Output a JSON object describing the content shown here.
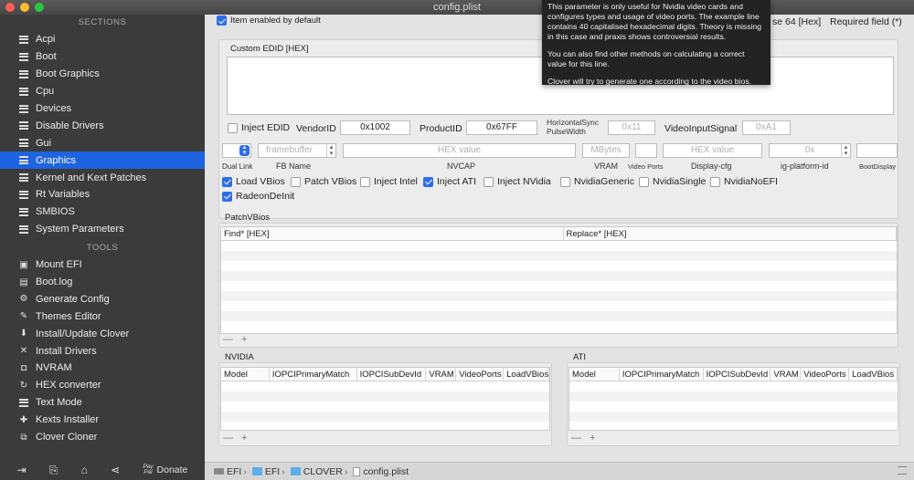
{
  "window": {
    "title": "config.plist"
  },
  "sidebar": {
    "sections_header": "SECTIONS",
    "sections": [
      {
        "label": "Acpi",
        "icon": "list-icon"
      },
      {
        "label": "Boot",
        "icon": "list-icon"
      },
      {
        "label": "Boot Graphics",
        "icon": "list-icon"
      },
      {
        "label": "Cpu",
        "icon": "list-icon"
      },
      {
        "label": "Devices",
        "icon": "list-icon"
      },
      {
        "label": "Disable Drivers",
        "icon": "list-icon"
      },
      {
        "label": "Gui",
        "icon": "list-icon"
      },
      {
        "label": "Graphics",
        "icon": "list-icon",
        "active": true
      },
      {
        "label": "Kernel and Kext Patches",
        "icon": "list-icon"
      },
      {
        "label": "Rt Variables",
        "icon": "list-icon"
      },
      {
        "label": "SMBIOS",
        "icon": "list-icon"
      },
      {
        "label": "System Parameters",
        "icon": "list-icon"
      }
    ],
    "tools_header": "TOOLS",
    "tools": [
      {
        "label": "Mount EFI",
        "icon": "disk-icon"
      },
      {
        "label": "Boot.log",
        "icon": "document-icon"
      },
      {
        "label": "Generate Config",
        "icon": "gears-icon"
      },
      {
        "label": "Themes Editor",
        "icon": "brush-icon"
      },
      {
        "label": "Install/Update Clover",
        "icon": "download-icon"
      },
      {
        "label": "Install Drivers",
        "icon": "tools-icon"
      },
      {
        "label": "NVRAM",
        "icon": "chip-icon"
      },
      {
        "label": "HEX converter",
        "icon": "refresh-icon"
      },
      {
        "label": "Text Mode",
        "icon": "list-icon"
      },
      {
        "label": "Kexts Installer",
        "icon": "puzzle-icon"
      },
      {
        "label": "Clover Cloner",
        "icon": "clone-icon"
      }
    ],
    "bottom": {
      "paypal_top": "Pay",
      "paypal_bottom": "Pal",
      "donate": "Donate"
    }
  },
  "main": {
    "item_enabled": "Item enabled by default",
    "right_header_base": "se 64 [Hex]",
    "right_header_required": "Required field (*)",
    "custom_edid_label": "Custom EDID [HEX]",
    "inject_edid": "Inject EDID",
    "vendor_id_label": "VendorID",
    "vendor_id": "0x1002",
    "product_id_label": "ProductID",
    "product_id": "0x67FF",
    "hsync_label_1": "HorizontalSync",
    "hsync_label_2": "PulseWidth",
    "hsync_value": "0x11",
    "video_input_label": "VideoInputSignal",
    "video_input_value": "0xA1",
    "framebuffer_ph": "framebuffer",
    "nvcap_ph": "HEX value",
    "vram_ph": "MBytes",
    "display_cfg_ph": "HEX value",
    "platform_id_ph": "0x",
    "labels_row": {
      "dual_link": "Dual Link",
      "fb_name": "FB Name",
      "nvcap": "NVCAP",
      "vram": "VRAM",
      "video_ports": "Video Ports",
      "display_cfg": "Display-cfg",
      "platform_id": "ig-platform-id",
      "boot_display": "BootDisplay"
    },
    "checks": [
      {
        "label": "Load VBios",
        "checked": true
      },
      {
        "label": "Patch VBios",
        "checked": false
      },
      {
        "label": "Inject Intel",
        "checked": false
      },
      {
        "label": "Inject ATI",
        "checked": true
      },
      {
        "label": "Inject NVidia",
        "checked": false
      },
      {
        "label": "NvidiaGeneric",
        "checked": false
      },
      {
        "label": "NvidiaSingle",
        "checked": false
      },
      {
        "label": "NvidiaNoEFI",
        "checked": false
      },
      {
        "label": "RadeonDeInit",
        "checked": true
      }
    ],
    "patch_vbios": {
      "title": "PatchVBios",
      "columns": [
        "Find* [HEX]",
        "Replace* [HEX]"
      ],
      "add_remove": "— +"
    },
    "nvidia": {
      "title": "NVIDIA",
      "columns": [
        "Model",
        "IOPCIPrimaryMatch",
        "IOPCISubDevId",
        "VRAM",
        "VideoPorts",
        "LoadVBios"
      ],
      "add_remove": "— +"
    },
    "ati": {
      "title": "ATI",
      "columns": [
        "Model",
        "IOPCIPrimaryMatch",
        "IOPCISubDevId",
        "VRAM",
        "VideoPorts",
        "LoadVBios"
      ],
      "add_remove": "— +"
    }
  },
  "tooltip": {
    "line1": "This parameter is only useful for Nvidia video cards and configures types and usage of video ports. The example line contains 40 capitalised hexadecimal digits. Theory is missing in this case and praxis shows controversial results.",
    "line2": "You can also find other methods on calculating a correct value for this line.",
    "line3": "Clover will try to generate one according to the video bios."
  },
  "statusbar": {
    "path": [
      "EFI",
      "EFI",
      "CLOVER",
      "config.plist"
    ]
  },
  "colors": {
    "accent": "#1e63e0",
    "sidebar_bg": "#3b3b3c",
    "checkbox_on": "#2f6ee9"
  }
}
